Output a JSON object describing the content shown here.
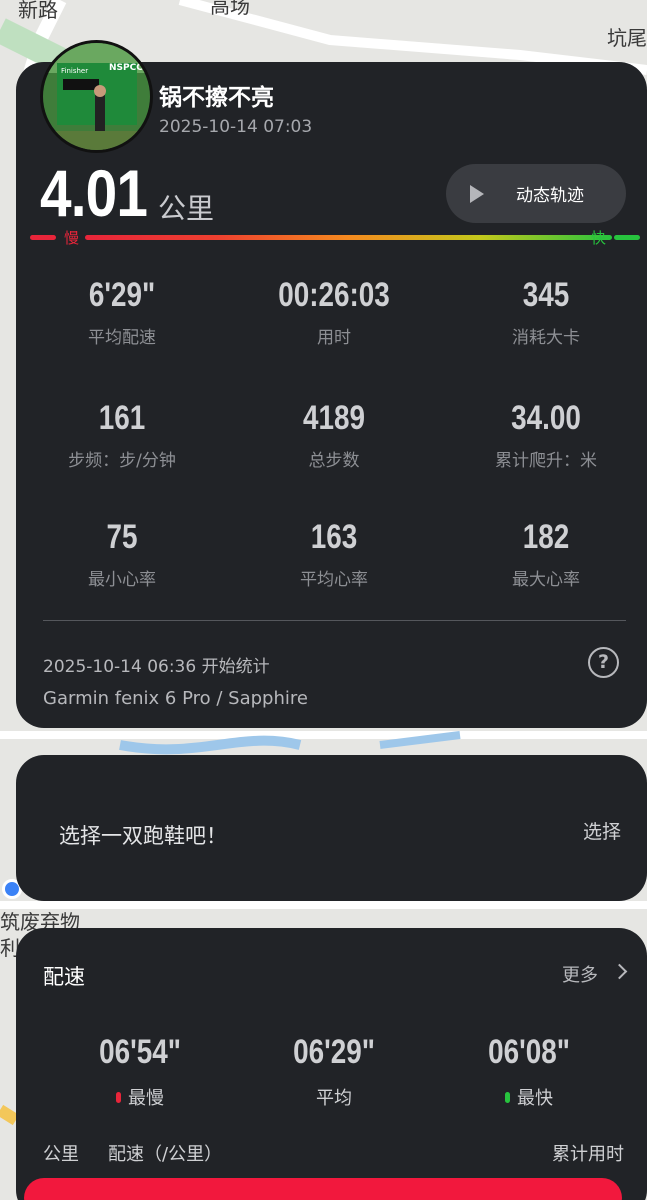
{
  "map": {
    "labels": [
      "新路",
      "高场",
      "坑尾",
      "筑废弃物",
      "利用"
    ],
    "pin_color": "#3b82f6"
  },
  "profile": {
    "username": "锅不擦不亮",
    "datetime": "2025-10-14 07:03",
    "avatar_icon": "runner-finisher-photo",
    "avatar_banner_text": "NSPCC",
    "avatar_banner_sub": "Finisher"
  },
  "summary": {
    "distance": "4.01",
    "distance_unit": "公里",
    "track_button": "动态轨迹",
    "speed_slow": "慢",
    "speed_fast": "快",
    "color_slow": "#e8253a",
    "color_fast": "#27c33e"
  },
  "stats": [
    {
      "value": "6'29\"",
      "label": "平均配速"
    },
    {
      "value": "00:26:03",
      "label": "用时"
    },
    {
      "value": "345",
      "label": "消耗大卡"
    },
    {
      "value": "161",
      "label": "步频：步/分钟"
    },
    {
      "value": "4189",
      "label": "总步数"
    },
    {
      "value": "34.00",
      "label": "累计爬升：米"
    },
    {
      "value": "75",
      "label": "最小心率"
    },
    {
      "value": "163",
      "label": "平均心率"
    },
    {
      "value": "182",
      "label": "最大心率"
    }
  ],
  "footer": {
    "start": "2025-10-14 06:36  开始统计",
    "device": "Garmin fenix 6 Pro / Sapphire",
    "help_symbol": "?"
  },
  "shoe": {
    "prompt": "选择一双跑鞋吧！",
    "select": "选择"
  },
  "pace": {
    "title": "配速",
    "more": "更多",
    "items": [
      {
        "value": "06'54\"",
        "label": "最慢",
        "dot_color": "#e8253a"
      },
      {
        "value": "06'29\"",
        "label": "平均",
        "dot_color": ""
      },
      {
        "value": "06'08\"",
        "label": "最快",
        "dot_color": "#27c33e"
      }
    ],
    "columns": [
      "公里",
      "配速（/公里）",
      "累计用时"
    ],
    "accent": "#f2183d"
  }
}
